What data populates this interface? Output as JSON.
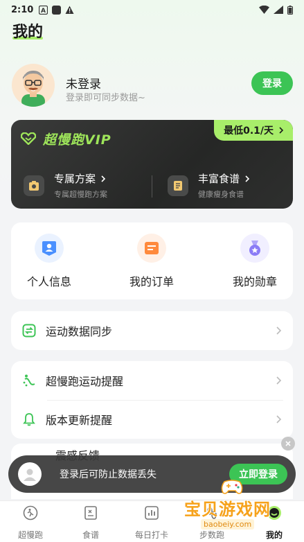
{
  "status_bar": {
    "time": "2:10"
  },
  "page": {
    "title": "我的"
  },
  "user": {
    "name": "未登录",
    "subtitle": "登录即可同步数据~",
    "login_label": "登录"
  },
  "vip": {
    "title": "超慢跑VIP",
    "price": "最低0.1/天",
    "features": [
      {
        "title": "专属方案",
        "subtitle": "专属超慢跑方案"
      },
      {
        "title": "丰富食谱",
        "subtitle": "健康瘦身食谱"
      }
    ]
  },
  "quick_actions": [
    {
      "label": "个人信息",
      "icon": "person-card-icon",
      "color": "#4a90ff"
    },
    {
      "label": "我的订单",
      "icon": "order-icon",
      "color": "#ff8a3d"
    },
    {
      "label": "我的勋章",
      "icon": "medal-icon",
      "color": "#8b7cf6"
    }
  ],
  "sync_row": {
    "label": "运动数据同步"
  },
  "reminders": [
    {
      "label": "超慢跑运动提醒"
    },
    {
      "label": "版本更新提醒"
    }
  ],
  "feedback": {
    "label": "震感反馈"
  },
  "toast": {
    "message": "登录后可防止数据丢失",
    "action": "立即登录"
  },
  "tabs": [
    {
      "label": "超慢跑"
    },
    {
      "label": "食谱"
    },
    {
      "label": "每日打卡"
    },
    {
      "label": "步数跑"
    },
    {
      "label": "我的"
    }
  ],
  "watermark": {
    "title": "宝贝游戏网",
    "url": "baobeiy.com"
  },
  "colors": {
    "accent": "#3cc455",
    "vip_green": "#a8ee6a"
  }
}
